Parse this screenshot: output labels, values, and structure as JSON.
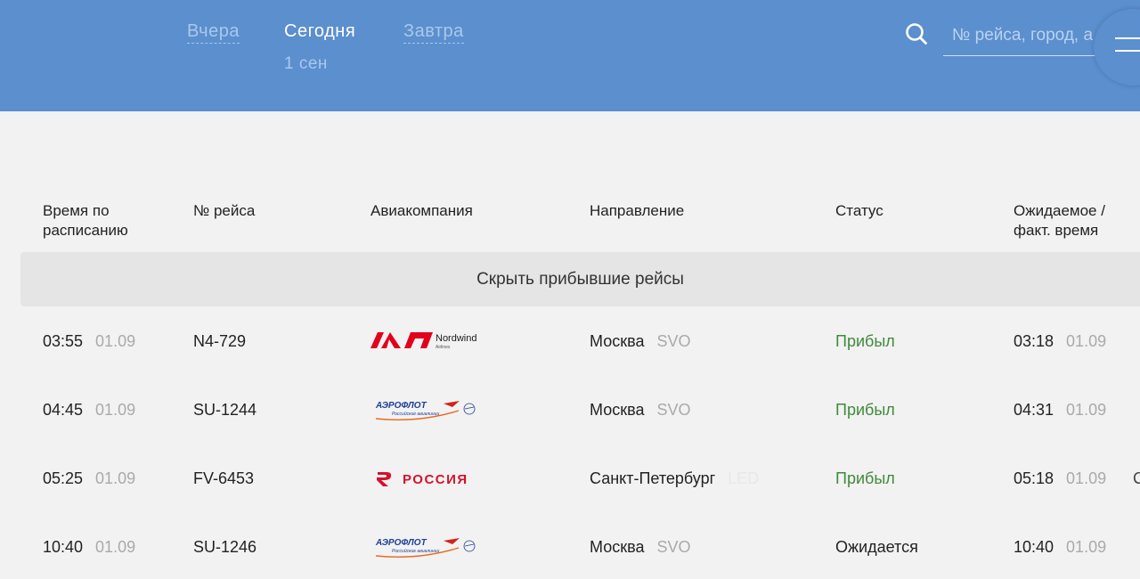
{
  "header": {
    "tabs": [
      {
        "label": "Вчера",
        "active": false
      },
      {
        "label": "Сегодня",
        "active": true
      },
      {
        "label": "Завтра",
        "active": false
      }
    ],
    "active_date": "1 сен",
    "search": {
      "placeholder": "№ рейса, город, а",
      "value": ""
    },
    "colors": {
      "header_bg": "#5b8fce",
      "arrived_status": "#3f8a3a"
    }
  },
  "table": {
    "headers": {
      "time": [
        "Время по",
        "расписанию"
      ],
      "flight": "№ рейса",
      "airline": "Авиакомпания",
      "direction": "Направление",
      "status": "Статус",
      "actual": [
        "Ожидаемое /",
        "факт. время"
      ]
    },
    "toggle_label": "Скрыть прибывшие рейсы",
    "rows": [
      {
        "time": "03:55",
        "date": "01.09",
        "flight": "N4-729",
        "airline_logo": "nordwind-logo",
        "airline_text": "Nordwind",
        "airline_sub": "Airlines",
        "city": "Москва",
        "airport": "SVO",
        "status": "Прибыл",
        "actual_time": "03:18",
        "actual_date": "01.09"
      },
      {
        "time": "04:45",
        "date": "01.09",
        "flight": "SU-1244",
        "airline_logo": "aeroflot-logo",
        "airline_text": "АЭРОФЛОТ",
        "airline_sub": "Российские авиалинии",
        "city": "Москва",
        "airport": "SVO",
        "status": "Прибыл",
        "actual_time": "04:31",
        "actual_date": "01.09"
      },
      {
        "time": "05:25",
        "date": "01.09",
        "flight": "FV-6453",
        "airline_logo": "rossiya-logo",
        "airline_text": "РОССИЯ",
        "city": "Санкт-Петербург",
        "airport": "LED",
        "status": "Прибыл",
        "actual_time": "05:18",
        "actual_date": "01.09",
        "edge_text": "С"
      },
      {
        "time": "10:40",
        "date": "01.09",
        "flight": "SU-1246",
        "airline_logo": "aeroflot-logo",
        "airline_text": "АЭРОФЛОТ",
        "airline_sub": "Российские авиалинии",
        "city": "Москва",
        "airport": "SVO",
        "status": "Ожидается",
        "actual_time": "10:40",
        "actual_date": "01.09"
      }
    ]
  }
}
